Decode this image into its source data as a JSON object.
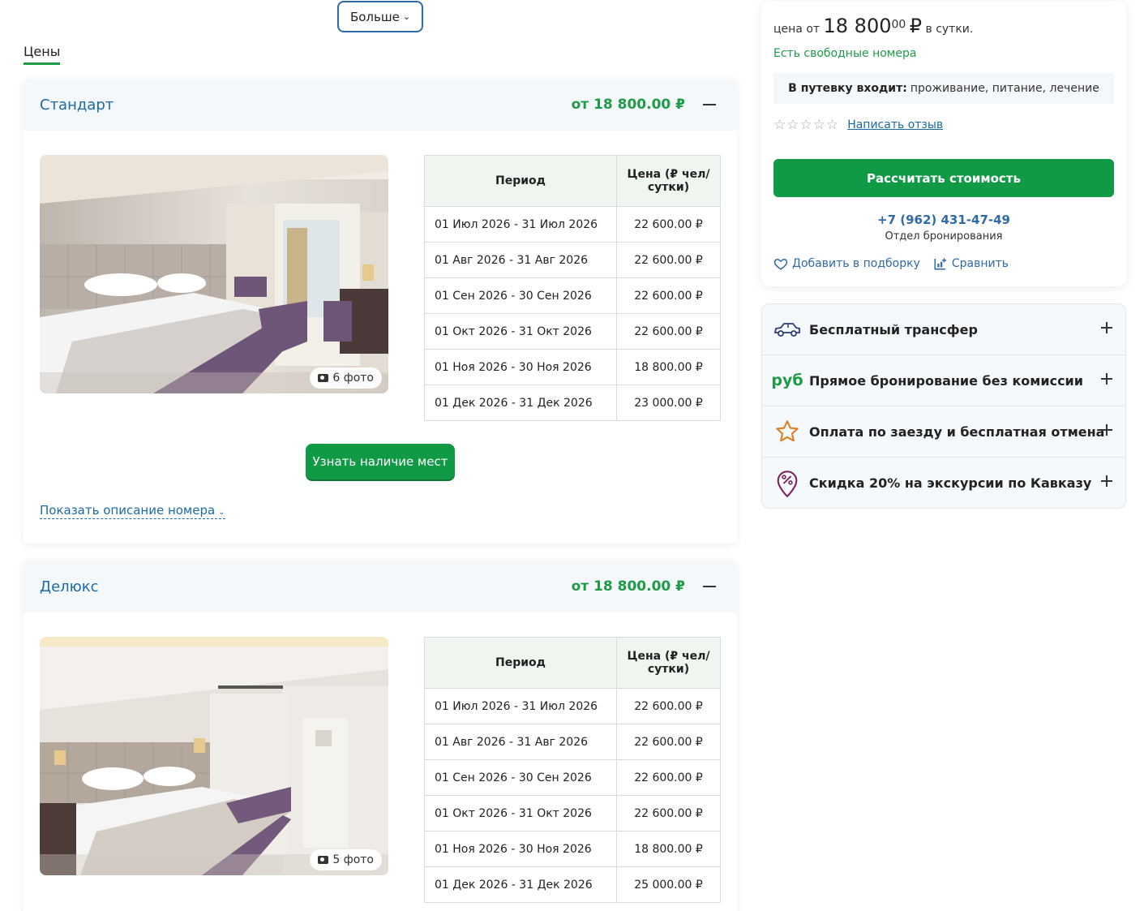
{
  "more_button": "Больше",
  "prices_tab": "Цены",
  "rooms": [
    {
      "name": "Стандарт",
      "price_from": "от 18 800.00 ₽",
      "photo_count": "6 фото",
      "table_headers": [
        "Период",
        "Цена (₽ чел/ сутки)"
      ],
      "rows": [
        {
          "period": "01 Июл 2026 - 31 Июл 2026",
          "price": "22 600.00 ₽"
        },
        {
          "period": "01 Авг 2026 - 31 Авг 2026",
          "price": "22 600.00 ₽"
        },
        {
          "period": "01 Сен 2026 - 30 Сен 2026",
          "price": "22 600.00 ₽"
        },
        {
          "period": "01 Окт 2026 - 31 Окт 2026",
          "price": "22 600.00 ₽"
        },
        {
          "period": "01 Ноя 2026 - 30 Ноя 2026",
          "price": "18 800.00 ₽"
        },
        {
          "period": "01 Дек 2026 - 31 Дек 2026",
          "price": "23 000.00 ₽"
        }
      ],
      "availability_button": "Узнать наличие мест",
      "show_description": "Показать описание номера"
    },
    {
      "name": "Делюкс",
      "price_from": "от 18 800.00 ₽",
      "photo_count": "5 фото",
      "table_headers": [
        "Период",
        "Цена (₽ чел/ сутки)"
      ],
      "rows": [
        {
          "period": "01 Июл 2026 - 31 Июл 2026",
          "price": "22 600.00 ₽"
        },
        {
          "period": "01 Авг 2026 - 31 Авг 2026",
          "price": "22 600.00 ₽"
        },
        {
          "period": "01 Сен 2026 - 30 Сен 2026",
          "price": "22 600.00 ₽"
        },
        {
          "period": "01 Окт 2026 - 31 Окт 2026",
          "price": "22 600.00 ₽"
        },
        {
          "period": "01 Ноя 2026 - 30 Ноя 2026",
          "price": "18 800.00 ₽"
        },
        {
          "period": "01 Дек 2026 - 31 Дек 2026",
          "price": "25 000.00 ₽"
        }
      ]
    }
  ],
  "booking": {
    "price_prefix": "цена от",
    "price_main": "18 800",
    "price_kop": "00",
    "price_currency": "₽",
    "price_suffix": "в сутки.",
    "availability": "Есть свободные номера",
    "included_label": "В путевку входит:",
    "included_text": "проживание, питание, лечение",
    "stars": "☆☆☆☆☆",
    "review_link": "Написать отзыв",
    "calc_button": "Рассчитать стоимость",
    "phone": "+7 (962) 431-47-49",
    "phone_sub": "Отдел бронирования",
    "add_to_collection": "Добавить в подборку",
    "compare": "Сравнить"
  },
  "features": [
    {
      "icon": "car-icon",
      "label": "Бесплатный трансфер"
    },
    {
      "icon": "ruble-icon",
      "label": "Прямое бронирование без комиссии",
      "icon_text": "руб"
    },
    {
      "icon": "star-icon",
      "label": "Оплата по заезду и бесплатная отмена"
    },
    {
      "icon": "discount-pin-icon",
      "label": "Скидка 20% на экскурсии по Кавказу"
    }
  ],
  "colors": {
    "accent_green": "#119a45",
    "link_blue": "#1b6aa5",
    "price_green": "#1e9b47"
  }
}
